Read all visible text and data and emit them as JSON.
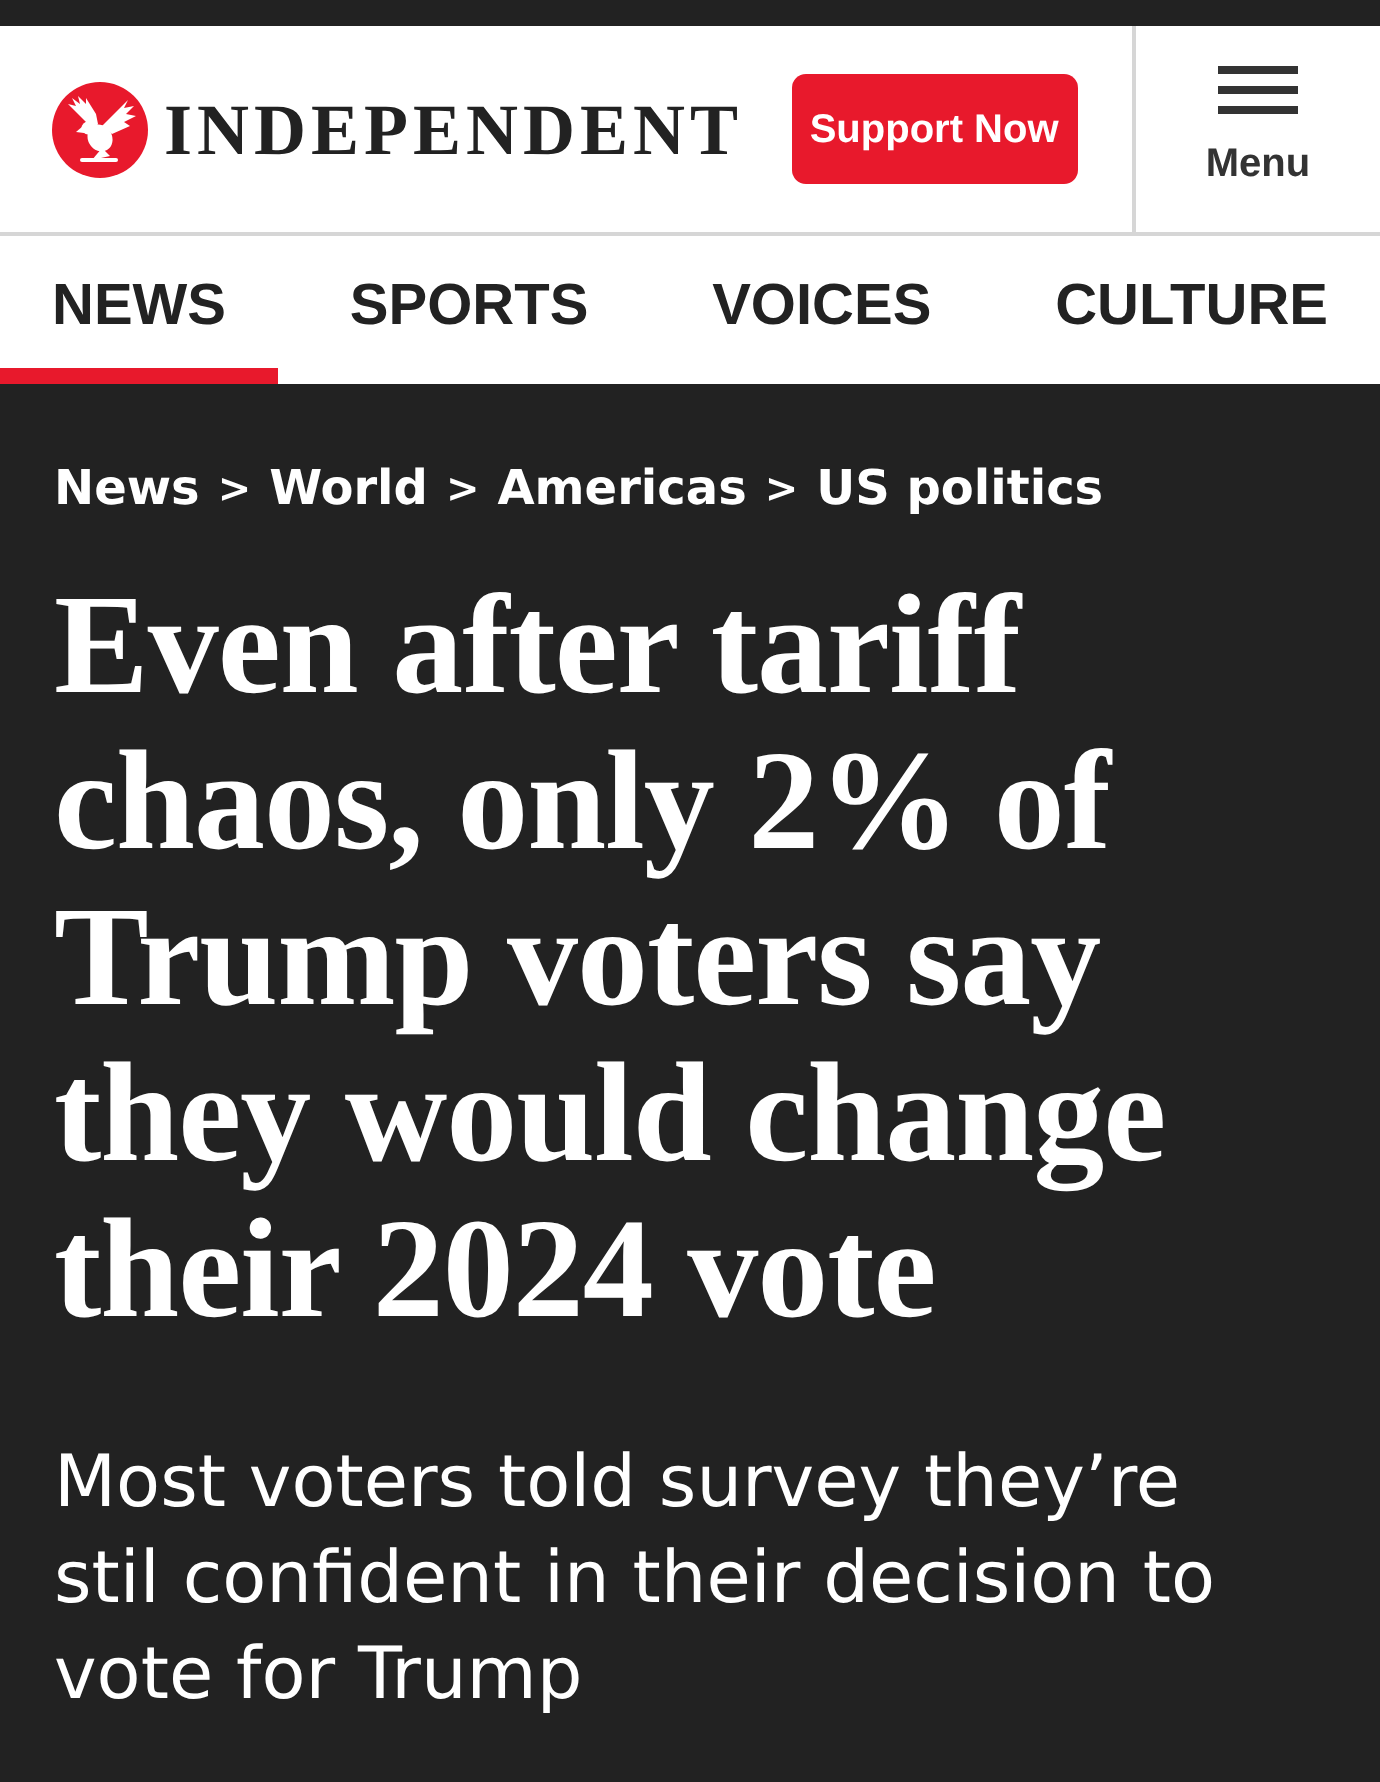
{
  "header": {
    "logo_text": "INDEPENDENT",
    "support_button": "Support Now",
    "menu_label": "Menu"
  },
  "nav": {
    "tabs": [
      {
        "label": "NEWS",
        "selected": true
      },
      {
        "label": "SPORTS",
        "selected": false
      },
      {
        "label": "VOICES",
        "selected": false
      },
      {
        "label": "CULTURE",
        "selected": false
      }
    ]
  },
  "article": {
    "breadcrumb": [
      {
        "kind": "link",
        "text": "News"
      },
      {
        "kind": "separator",
        "text": ">"
      },
      {
        "kind": "link",
        "text": "World"
      },
      {
        "kind": "separator",
        "text": ">"
      },
      {
        "kind": "link",
        "text": "Americas"
      },
      {
        "kind": "separator",
        "text": ">"
      },
      {
        "kind": "link",
        "text": "US politics"
      }
    ],
    "headline": "Even after tariff chaos, only 2% of Trump voters say they would change their 2024 vote",
    "standfirst": "Most voters told survey they’re stil confident in their decision to vote for Trump"
  }
}
